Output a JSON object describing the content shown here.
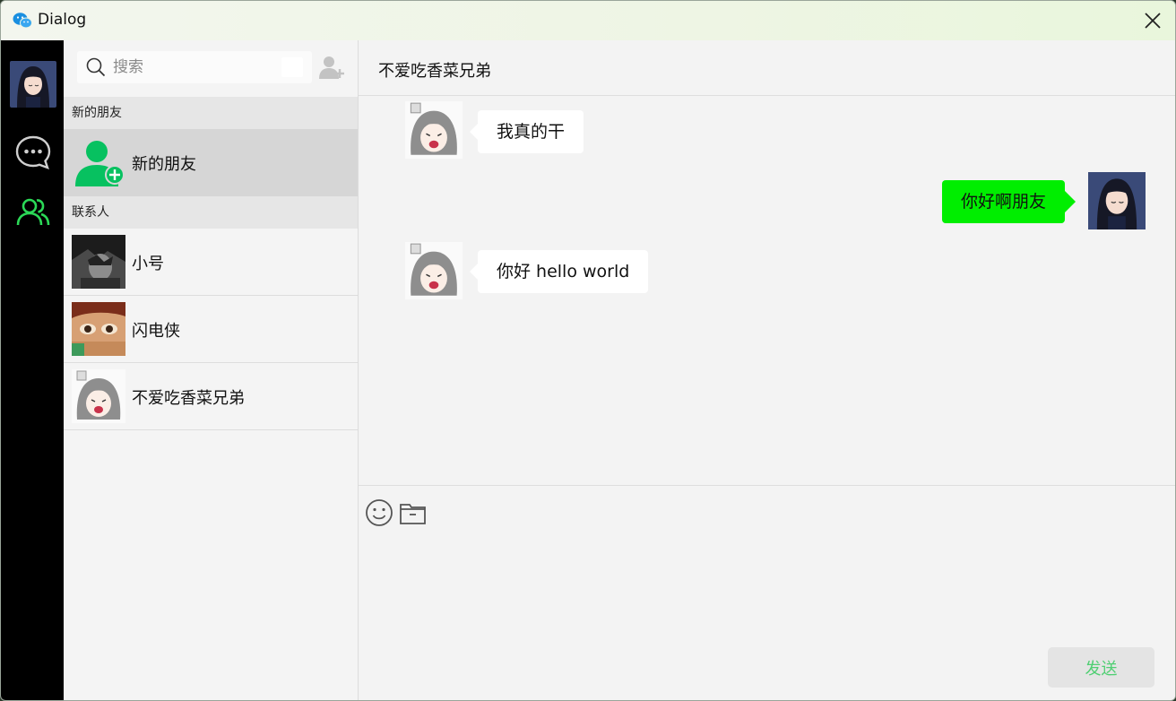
{
  "window": {
    "title": "Dialog"
  },
  "sidebar": {
    "search": {
      "placeholder": "搜索",
      "value": ""
    },
    "sections": {
      "new_friends_header": "新的朋友",
      "contacts_header": "联系人"
    },
    "new_friend_item": {
      "label": "新的朋友"
    },
    "contacts": [
      {
        "name": "小号"
      },
      {
        "name": "闪电侠"
      },
      {
        "name": "不爱吃香菜兄弟"
      }
    ]
  },
  "chat": {
    "title": "不爱吃香菜兄弟",
    "messages": [
      {
        "side": "left",
        "text": "我真的干"
      },
      {
        "side": "right",
        "text": "你好啊朋友"
      },
      {
        "side": "left",
        "text": "你好 hello world"
      }
    ],
    "send_label": "发送"
  },
  "colors": {
    "accent_green": "#07c160",
    "active_nav_green": "#2bd957",
    "own_bubble": "#00ee00",
    "send_text": "#4fcf72"
  },
  "icons": [
    "wechat-logo-icon",
    "close-icon",
    "chat-bubble-icon",
    "contacts-icon",
    "search-icon",
    "add-contact-icon",
    "add-friend-icon",
    "emoji-icon",
    "folder-icon"
  ]
}
